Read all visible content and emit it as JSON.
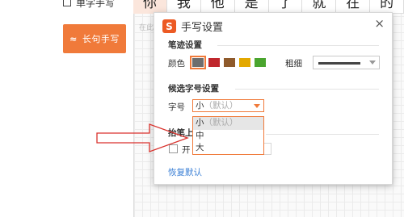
{
  "left": {
    "single_hand_label": "单字手写",
    "longhand_icon": "≈",
    "longhand_label": "长句手写"
  },
  "candidates": [
    "你",
    "我",
    "他",
    "是",
    "了",
    "就",
    "在",
    "的"
  ],
  "canvas_hint": "在此",
  "dialog": {
    "logo_letter": "S",
    "title": "手写设置",
    "close": "×",
    "stroke_section": "笔迹设置",
    "color_label": "颜色",
    "colors": [
      "#6e6e6e",
      "#c0272d",
      "#8f5a2b",
      "#e3a800",
      "#4aa52e"
    ],
    "selected_color_index": 0,
    "thickness_label": "粗细",
    "candidate_section": "候选字号设置",
    "size_label": "字号",
    "size_selected": "小",
    "size_selected_note": "（默认）",
    "size_options": [
      {
        "label": "小",
        "note": "（默认）"
      },
      {
        "label": "中",
        "note": ""
      },
      {
        "label": "大",
        "note": ""
      }
    ],
    "pickup_section": "抬笔上",
    "checkbox_label": "开",
    "restore_link": "恢复默认"
  }
}
